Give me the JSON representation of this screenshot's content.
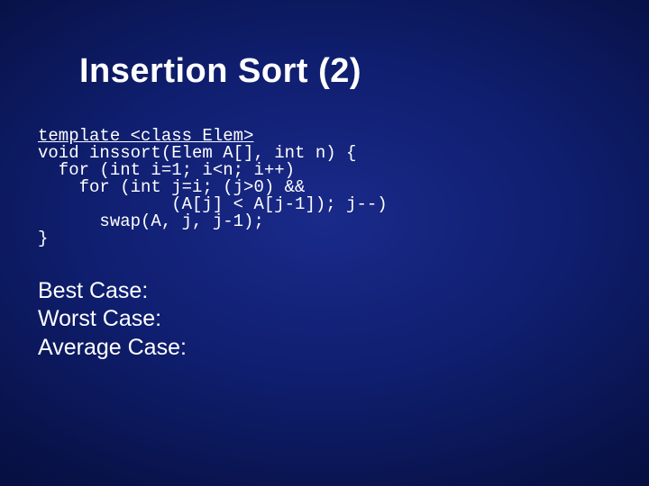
{
  "title": "Insertion Sort (2)",
  "code": {
    "line1": "template <class Elem>",
    "line2": "void inssort(Elem A[], int n) {",
    "line3": "  for (int i=1; i<n; i++)",
    "line4": "    for (int j=i; (j>0) &&",
    "line5": "             (A[j] < A[j-1]); j--)",
    "line6": "      swap(A, j, j-1);",
    "line7": "}"
  },
  "analysis": {
    "best": "Best Case:",
    "worst": "Worst Case:",
    "average": "Average Case:"
  }
}
